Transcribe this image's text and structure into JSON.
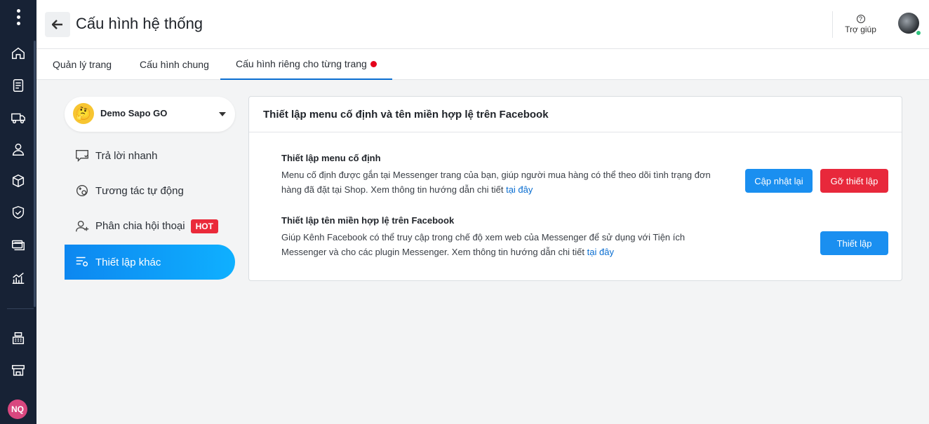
{
  "header": {
    "title": "Cấu hình hệ thống",
    "help_label": "Trợ giúp"
  },
  "user": {
    "initials": "NQ"
  },
  "tabs": [
    {
      "label": "Quản lý trang"
    },
    {
      "label": "Cấu hình chung"
    },
    {
      "label": "Cấu hình riêng cho từng trang",
      "active": true
    }
  ],
  "sidebar": {
    "page_name": "Demo Sapo GO",
    "items": [
      {
        "label": "Trả lời nhanh",
        "icon": "quick-reply-icon"
      },
      {
        "label": "Tương tác tự động",
        "icon": "auto-interaction-icon"
      },
      {
        "label": "Phân chia hội thoại",
        "icon": "assign-user-icon",
        "badge": "HOT"
      },
      {
        "label": "Thiết lập khác",
        "icon": "settings-list-icon",
        "active": true
      }
    ]
  },
  "card": {
    "title": "Thiết lập menu cố định và tên miền hợp lệ trên Facebook",
    "sections": [
      {
        "heading": "Thiết lập menu cố định",
        "desc_line1": "Menu cố định được gắn tại Messenger trang của bạn, giúp người mua hàng có thể theo dõi tình trạng đơn",
        "desc_line2": "hàng đã đặt tại Shop. Xem thông tin hướng dẫn chi tiết",
        "link": "tại đây",
        "buttons": [
          "Cập nhật lại",
          "Gỡ thiết lập"
        ]
      },
      {
        "heading": "Thiết lập tên miền hợp lệ trên Facebook",
        "desc_line1": "Giúp Kênh Facebook có thể truy cập trong chế độ xem web của Messenger để sử dụng với Tiện ích",
        "desc_line2": "Messenger và cho các plugin Messenger. Xem thông tin hướng dẫn chi tiết",
        "link": "tại đây",
        "buttons": [
          "Thiết lập"
        ]
      }
    ]
  },
  "colors": {
    "rail": "#172235",
    "accent": "#1a8ff0",
    "danger": "#e8283b",
    "online": "#2ec27e"
  }
}
